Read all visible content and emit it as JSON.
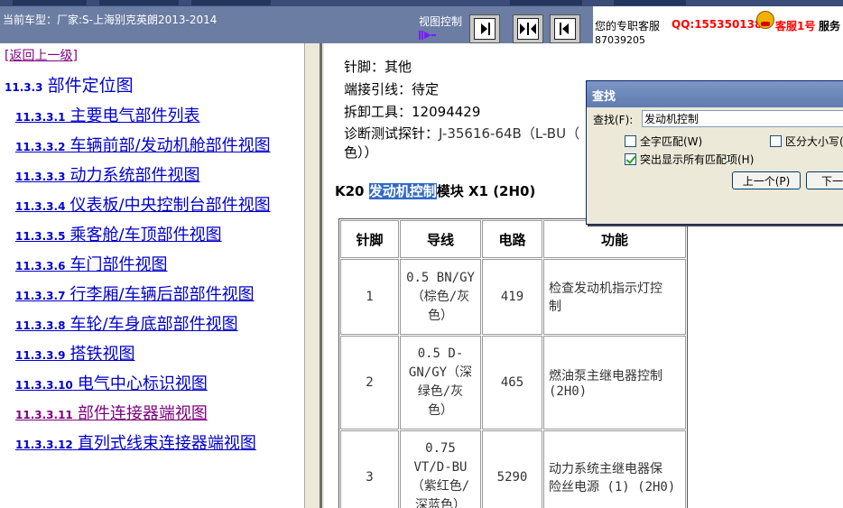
{
  "header": {
    "vehicle_info": "当前车型：厂家:S-上海别克英朗2013-2014",
    "view_control_label": "视图控制"
  },
  "service": {
    "label": "您的专职客服",
    "qq": "QQ:1553501388",
    "agent_name": "客服1号",
    "suffix": "服务",
    "number": "87039205"
  },
  "nav": {
    "back": "[返回上一级]",
    "section": {
      "num": "11.3.3",
      "title": "部件定位图"
    },
    "items": [
      {
        "num": "11.3.3.1",
        "title": "主要电气部件列表"
      },
      {
        "num": "11.3.3.2",
        "title": "车辆前部/发动机舱部件视图"
      },
      {
        "num": "11.3.3.3",
        "title": "动力系统部件视图"
      },
      {
        "num": "11.3.3.4",
        "title": "仪表板/中央控制台部件视图"
      },
      {
        "num": "11.3.3.5",
        "title": "乘客舱/车顶部件视图"
      },
      {
        "num": "11.3.3.6",
        "title": "车门部件视图"
      },
      {
        "num": "11.3.3.7",
        "title": "行李厢/车辆后部部件视图"
      },
      {
        "num": "11.3.3.8",
        "title": "车轮/车身底部部件视图"
      },
      {
        "num": "11.3.3.9",
        "title": "搭铁视图"
      },
      {
        "num": "11.3.3.10",
        "title": "电气中心标识视图"
      },
      {
        "num": "11.3.3.11",
        "title": "部件连接器端视图"
      },
      {
        "num": "11.3.3.12",
        "title": "直列式线束连接器端视图"
      }
    ]
  },
  "content": {
    "pin_label": "针脚：",
    "pin_value": "其他",
    "terminal_label": "端接引线：",
    "terminal_value": "待定",
    "tool_label": "拆卸工具：",
    "tool_value": "12094429",
    "probe_label": "诊断测试探针：",
    "probe_value": "J-35616-64B（L-BU（",
    "probe_cont": "色））",
    "connector_prefix": "K20 ",
    "connector_highlight": "发动机控制",
    "connector_suffix": "模块  X1 (2H0)",
    "table": {
      "headers": [
        "针脚",
        "导线",
        "电路",
        "功能"
      ],
      "rows": [
        {
          "pin": "1",
          "wire": [
            "0.5 BN/GY",
            "（棕色/灰",
            "色）"
          ],
          "circuit": "419",
          "function": [
            "检查发动机指示灯控",
            "制"
          ]
        },
        {
          "pin": "2",
          "wire": [
            "0.5 D-",
            "GN/GY（深",
            "绿色/灰",
            "色）"
          ],
          "circuit": "465",
          "function": [
            "燃油泵主继电器控制",
            "(2H0)"
          ]
        },
        {
          "pin": "3",
          "wire": [
            "0.75",
            "VT/D-BU",
            "（紫红色/",
            "深蓝色）"
          ],
          "circuit": "5290",
          "function": [
            "动力系统主继电器保",
            "险丝电源 (1) (2H0)"
          ]
        }
      ]
    }
  },
  "find_dialog": {
    "title": "查找",
    "find_label": "查找(F):",
    "find_value": "发动机控制",
    "whole_word": "全字匹配(W)",
    "match_case": "区分大小写(",
    "highlight_all": "突出显示所有匹配项(H)",
    "prev": "上一个(P)",
    "next": "下一个"
  }
}
